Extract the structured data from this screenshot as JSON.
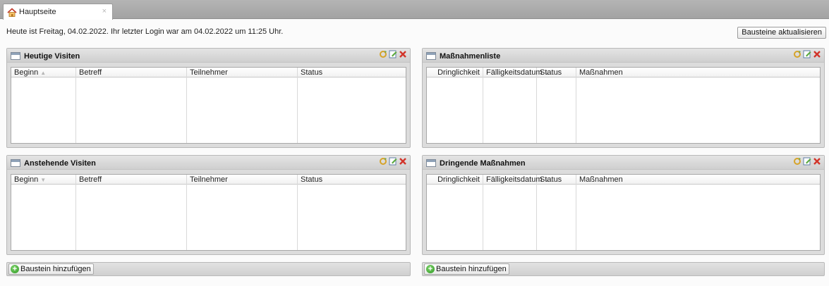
{
  "tab": {
    "label": "Hauptseite",
    "close": "×"
  },
  "welcome_text": "Heute ist Freitag, 04.02.2022. Ihr letzter Login war am 04.02.2022 um 11:25 Uhr.",
  "refresh_button": "Bausteine aktualisieren",
  "portlets": {
    "heutige_visiten": {
      "title": "Heutige Visiten",
      "columns": [
        "Beginn",
        "Betreff",
        "Teilnehmer",
        "Status"
      ],
      "sort_column": "Beginn",
      "sort_direction": "ascending",
      "rows": []
    },
    "anstehende_visiten": {
      "title": "Anstehende Visiten",
      "columns": [
        "Beginn",
        "Betreff",
        "Teilnehmer",
        "Status"
      ],
      "sort_column": "Beginn",
      "sort_direction": "descending",
      "rows": []
    },
    "massnahmenliste": {
      "title": "Maßnahmenliste",
      "columns": [
        "Dringlichkeit",
        "Fälligkeitsdatum",
        "Status",
        "Maßnahmen"
      ],
      "sort_column": "Fälligkeitsdatum",
      "sort_direction": "ascending",
      "rows": []
    },
    "dringende_massnahmen": {
      "title": "Dringende Maßnahmen",
      "columns": [
        "Dringlichkeit",
        "Fälligkeitsdatum",
        "Status",
        "Maßnahmen"
      ],
      "sort_column": "Fälligkeitsdatum",
      "sort_direction": "ascending",
      "rows": []
    }
  },
  "add_buttons": {
    "left": "Baustein hinzufügen",
    "right": "Baustein hinzufügen"
  },
  "icons": {
    "tab": "home-icon",
    "portlet_header": "window-icon",
    "tools": [
      "refresh-icon",
      "edit-icon",
      "close-icon"
    ],
    "add": "add-icon"
  },
  "colors": {
    "close_red": "#d2342a",
    "add_green": "#2e9a24",
    "tab_strip": "#a9a9a9"
  }
}
